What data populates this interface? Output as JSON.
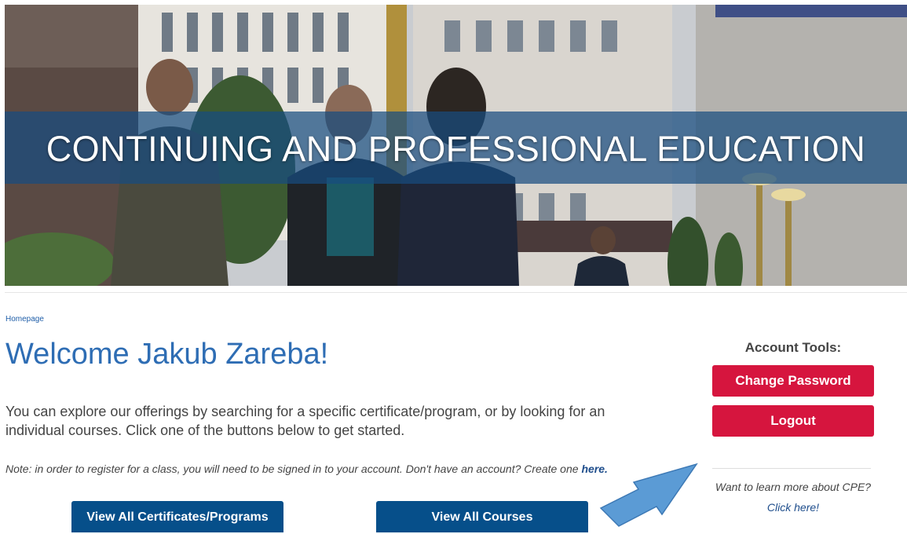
{
  "hero": {
    "banner_title": "CONTINUING AND PROFESSIONAL EDUCATION"
  },
  "breadcrumb": {
    "label": "Homepage"
  },
  "main": {
    "welcome": "Welcome Jakub Zareba!",
    "intro": "You can explore our offerings by searching for a specific certificate/program, or by looking for an individual courses. Click one of the buttons below to get started.",
    "note_text": "Note: in order to register for a class, you will need to be signed in to your account. Don't have an account? Create one ",
    "note_link": "here.",
    "buttons": {
      "certificates": "View All Certificates/Programs",
      "courses": "View All Courses"
    }
  },
  "sidebar": {
    "title": "Account Tools:",
    "change_password": "Change Password",
    "logout": "Logout",
    "learn_more": "Want to learn more about CPE?",
    "click_here": "Click here!"
  },
  "colors": {
    "brand_blue": "#064f8a",
    "heading_blue": "#2e6db4",
    "action_red": "#d6153e",
    "arrow_blue": "#5b9bd5"
  },
  "annotation": {
    "icon": "arrow-pointer-icon"
  }
}
